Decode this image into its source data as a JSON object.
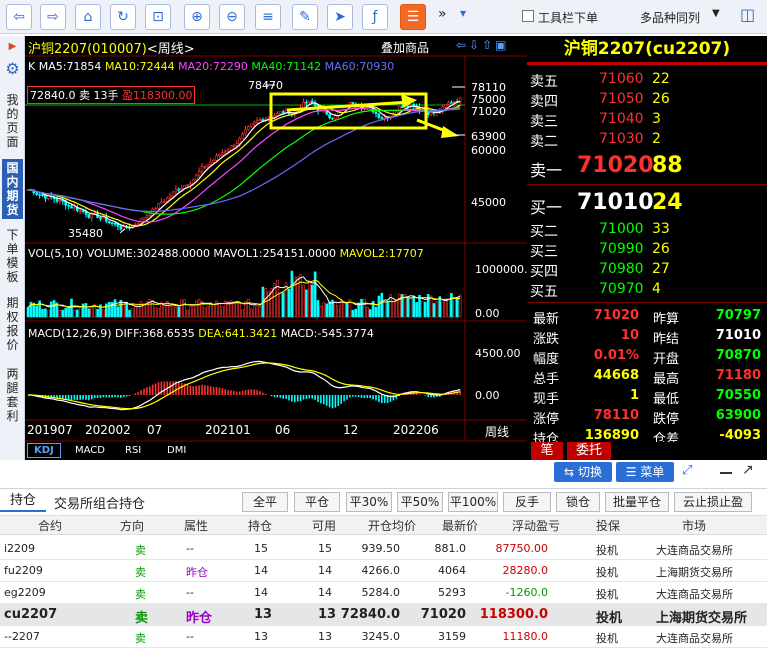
{
  "toolbar": {
    "more": "»",
    "toolbar_below": "工具栏下单",
    "multi_same": "多品种同列"
  },
  "sidebar": {
    "items": [
      "我的页面",
      "国内期货",
      "下单模板",
      "期权报价",
      "两腿套利"
    ]
  },
  "chart": {
    "symbol": "沪铜2207",
    "code": "(010007)",
    "period": "<周线>",
    "overlay": "叠加商品",
    "ma_prefix": "K",
    "ma": [
      {
        "label": "MA5:71854",
        "color": "#ffffff"
      },
      {
        "label": "MA10:72444",
        "color": "#ffff00"
      },
      {
        "label": "MA20:72290",
        "color": "#ff44ff"
      },
      {
        "label": "MA40:71142",
        "color": "#00ff00"
      },
      {
        "label": "MA60:70930",
        "color": "#6a6aff"
      }
    ],
    "position_tag": {
      "prefix": "72840.0 卖 13手",
      "profit": "盈118300.00"
    },
    "price_axis": [
      "78110",
      "75000",
      "71020",
      "63900",
      "60000",
      "45000"
    ],
    "high_label": "78470",
    "low_label": "35480",
    "vol_label": "VOL(5,10) VOLUME:302488.0000 MAVOL1:254151.0000",
    "vol_label2": "MAVOL2:17707",
    "vol_axis": [
      "1000000.",
      "0.00"
    ],
    "macd_label": "MACD(12,26,9) DIFF:368.6535",
    "macd_dea": "DEA:641.3421",
    "macd_val": "MACD:-545.3774",
    "macd_axis": [
      "4500.00",
      "0.00"
    ],
    "dates": [
      "201907",
      "202002",
      "07",
      "202101",
      "06",
      "12",
      "202206"
    ],
    "period_label": "周线",
    "tabs": [
      "KDJ",
      "MACD",
      "RSI",
      "DMI"
    ]
  },
  "quote": {
    "title": "沪铜2207(cu2207)",
    "asks": [
      {
        "label": "卖五",
        "price": "71060",
        "vol": "22"
      },
      {
        "label": "卖四",
        "price": "71050",
        "vol": "26"
      },
      {
        "label": "卖三",
        "price": "71040",
        "vol": "3"
      },
      {
        "label": "卖二",
        "price": "71030",
        "vol": "2"
      }
    ],
    "ask1": {
      "label": "卖一",
      "price": "71020",
      "vol": "88"
    },
    "bid1": {
      "label": "买一",
      "price": "71010",
      "vol": "24"
    },
    "bids": [
      {
        "label": "买二",
        "price": "71000",
        "vol": "33"
      },
      {
        "label": "买三",
        "price": "70990",
        "vol": "26"
      },
      {
        "label": "买四",
        "price": "70980",
        "vol": "27"
      },
      {
        "label": "买五",
        "price": "70970",
        "vol": "4"
      }
    ],
    "stats": [
      {
        "l1": "最新",
        "v1": "71020",
        "c1": "#ff3030",
        "l2": "昨算",
        "v2": "70797",
        "c2": "#00ff00"
      },
      {
        "l1": "涨跌",
        "v1": "10",
        "c1": "#ff3030",
        "l2": "昨结",
        "v2": "71010",
        "c2": "#ffffff"
      },
      {
        "l1": "幅度",
        "v1": "0.01%",
        "c1": "#ff3030",
        "l2": "开盘",
        "v2": "70870",
        "c2": "#00ff00"
      },
      {
        "l1": "总手",
        "v1": "44668",
        "c1": "#ffff00",
        "l2": "最高",
        "v2": "71180",
        "c2": "#ff3030"
      },
      {
        "l1": "现手",
        "v1": "1",
        "c1": "#ffff00",
        "l2": "最低",
        "v2": "70550",
        "c2": "#00ff00"
      },
      {
        "l1": "涨停",
        "v1": "78110",
        "c1": "#ff3030",
        "l2": "跌停",
        "v2": "63900",
        "c2": "#00ff00"
      },
      {
        "l1": "持仓",
        "v1": "136890",
        "c1": "#ffff00",
        "l2": "仓差",
        "v2": "-4093",
        "c2": "#ffff00"
      }
    ],
    "tab_bi": "笔",
    "tab_wt": "委托"
  },
  "bottom": {
    "switch_btn": "切换",
    "menu_btn": "菜单",
    "tab_position": "持仓",
    "tab_combo": "交易所组合持仓",
    "buttons": [
      "全平",
      "平仓",
      "平30%",
      "平50%",
      "平100%",
      "反手",
      "锁仓",
      "批量平仓",
      "云止损止盈"
    ],
    "headers": [
      "合约",
      "方向",
      "属性",
      "持仓",
      "可用",
      "开仓均价",
      "最新价",
      "浮动盈亏",
      "投保",
      "市场"
    ],
    "rows": [
      {
        "contract": "i2209",
        "dir": "卖",
        "attr": "--",
        "pos": "15",
        "avail": "15",
        "open": "939.50",
        "last": "881.0",
        "pnl": "87750.00",
        "pnl_color": "#cc0000",
        "hedge": "投机",
        "market": "大连商品交易所"
      },
      {
        "contract": "fu2209",
        "dir": "卖",
        "attr": "昨仓",
        "pos": "14",
        "avail": "14",
        "open": "4266.0",
        "last": "4064",
        "pnl": "28280.0",
        "pnl_color": "#cc0000",
        "hedge": "投机",
        "market": "上海期货交易所"
      },
      {
        "contract": "eg2209",
        "dir": "卖",
        "attr": "--",
        "pos": "14",
        "avail": "14",
        "open": "5284.0",
        "last": "5293",
        "pnl": "-1260.0",
        "pnl_color": "#009900",
        "hedge": "投机",
        "market": "大连商品交易所"
      },
      {
        "contract": "cu2207",
        "dir": "卖",
        "attr": "昨仓",
        "pos": "13",
        "avail": "13",
        "open": "72840.0",
        "last": "71020",
        "pnl": "118300.0",
        "pnl_color": "#cc0000",
        "hedge": "投机",
        "market": "上海期货交易所"
      },
      {
        "contract": "--2207",
        "dir": "卖",
        "attr": "--",
        "pos": "13",
        "avail": "13",
        "open": "3245.0",
        "last": "3159",
        "pnl": "11180.0",
        "pnl_color": "#cc0000",
        "hedge": "投机",
        "market": "大连商品交易所"
      }
    ]
  }
}
